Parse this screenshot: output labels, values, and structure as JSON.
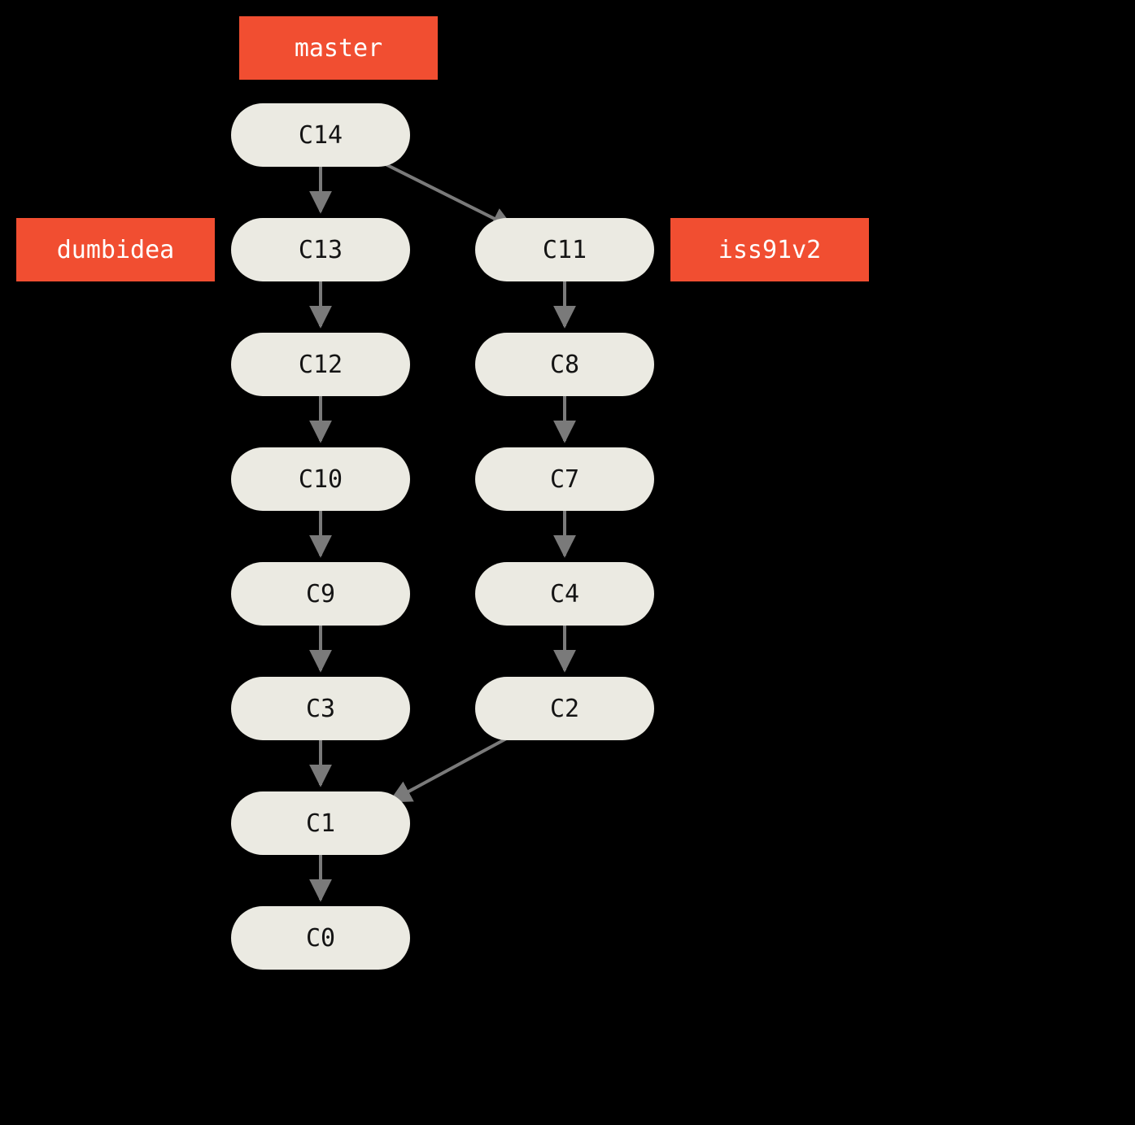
{
  "diagram": {
    "type": "git-commit-graph",
    "branches": {
      "master": {
        "label": "master"
      },
      "dumbidea": {
        "label": "dumbidea"
      },
      "iss91v2": {
        "label": "iss91v2"
      }
    },
    "commits": {
      "c14": {
        "label": "C14"
      },
      "c13": {
        "label": "C13"
      },
      "c12": {
        "label": "C12"
      },
      "c11": {
        "label": "C11"
      },
      "c10": {
        "label": "C10"
      },
      "c9": {
        "label": "C9"
      },
      "c8": {
        "label": "C8"
      },
      "c7": {
        "label": "C7"
      },
      "c4": {
        "label": "C4"
      },
      "c3": {
        "label": "C3"
      },
      "c2": {
        "label": "C2"
      },
      "c1": {
        "label": "C1"
      },
      "c0": {
        "label": "C0"
      }
    },
    "edges": [
      [
        "c14",
        "c13"
      ],
      [
        "c14",
        "c11"
      ],
      [
        "c13",
        "c12"
      ],
      [
        "c12",
        "c10"
      ],
      [
        "c10",
        "c9"
      ],
      [
        "c9",
        "c3"
      ],
      [
        "c3",
        "c1"
      ],
      [
        "c1",
        "c0"
      ],
      [
        "c11",
        "c8"
      ],
      [
        "c8",
        "c7"
      ],
      [
        "c7",
        "c4"
      ],
      [
        "c4",
        "c2"
      ],
      [
        "c2",
        "c1"
      ]
    ],
    "branch_heads": {
      "master": "c14",
      "dumbidea": "c13",
      "iss91v2": "c11"
    },
    "colors": {
      "branch_bg": "#f14e31",
      "branch_fg": "#ffffff",
      "commit_bg": "#ebeae2",
      "commit_fg": "#141414",
      "edge": "#7a7a7a",
      "canvas_bg": "#000000"
    }
  }
}
